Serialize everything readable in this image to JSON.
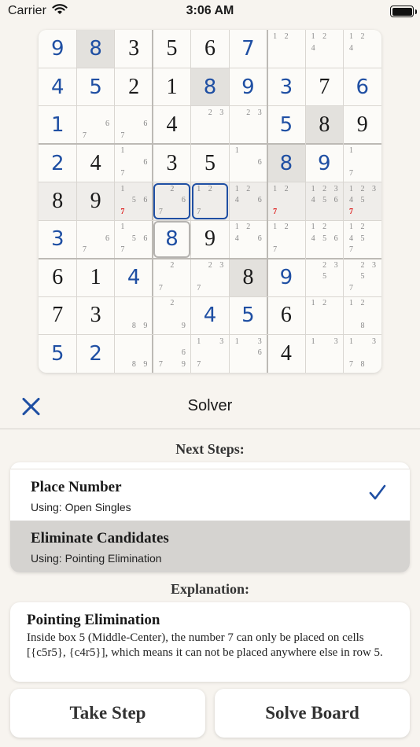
{
  "status_bar": {
    "carrier": "Carrier",
    "time": "3:06 AM"
  },
  "board": {
    "cells": [
      {
        "r": 0,
        "c": 0,
        "v": "9",
        "t": "user"
      },
      {
        "r": 0,
        "c": 1,
        "v": "8",
        "t": "user",
        "sel": true
      },
      {
        "r": 0,
        "c": 2,
        "v": "3",
        "t": "given"
      },
      {
        "r": 0,
        "c": 3,
        "v": "5",
        "t": "given"
      },
      {
        "r": 0,
        "c": 4,
        "v": "6",
        "t": "given"
      },
      {
        "r": 0,
        "c": 5,
        "v": "7",
        "t": "user"
      },
      {
        "r": 0,
        "c": 6,
        "pm": [
          "1",
          "2"
        ]
      },
      {
        "r": 0,
        "c": 7,
        "pm": [
          "1",
          "2",
          "4"
        ]
      },
      {
        "r": 0,
        "c": 8,
        "pm": [
          "1",
          "2",
          "4"
        ]
      },
      {
        "r": 1,
        "c": 0,
        "v": "4",
        "t": "user"
      },
      {
        "r": 1,
        "c": 1,
        "v": "5",
        "t": "user"
      },
      {
        "r": 1,
        "c": 2,
        "v": "2",
        "t": "given"
      },
      {
        "r": 1,
        "c": 3,
        "v": "1",
        "t": "given"
      },
      {
        "r": 1,
        "c": 4,
        "v": "8",
        "t": "user",
        "sel": true
      },
      {
        "r": 1,
        "c": 5,
        "v": "9",
        "t": "user"
      },
      {
        "r": 1,
        "c": 6,
        "v": "3",
        "t": "user"
      },
      {
        "r": 1,
        "c": 7,
        "v": "7",
        "t": "given"
      },
      {
        "r": 1,
        "c": 8,
        "v": "6",
        "t": "user"
      },
      {
        "r": 2,
        "c": 0,
        "v": "1",
        "t": "user"
      },
      {
        "r": 2,
        "c": 1,
        "pm": [
          "6",
          "7"
        ]
      },
      {
        "r": 2,
        "c": 2,
        "pm": [
          "6",
          "7"
        ]
      },
      {
        "r": 2,
        "c": 3,
        "v": "4",
        "t": "given"
      },
      {
        "r": 2,
        "c": 4,
        "pm": [
          "2",
          "3"
        ]
      },
      {
        "r": 2,
        "c": 5,
        "pm": [
          "2",
          "3"
        ]
      },
      {
        "r": 2,
        "c": 6,
        "v": "5",
        "t": "user"
      },
      {
        "r": 2,
        "c": 7,
        "v": "8",
        "t": "given",
        "sel": true
      },
      {
        "r": 2,
        "c": 8,
        "v": "9",
        "t": "given"
      },
      {
        "r": 3,
        "c": 0,
        "v": "2",
        "t": "user"
      },
      {
        "r": 3,
        "c": 1,
        "v": "4",
        "t": "given"
      },
      {
        "r": 3,
        "c": 2,
        "pm": [
          "1",
          "6",
          "7"
        ]
      },
      {
        "r": 3,
        "c": 3,
        "v": "3",
        "t": "given"
      },
      {
        "r": 3,
        "c": 4,
        "v": "5",
        "t": "given"
      },
      {
        "r": 3,
        "c": 5,
        "pm": [
          "1",
          "6"
        ]
      },
      {
        "r": 3,
        "c": 6,
        "v": "8",
        "t": "user",
        "sel": true
      },
      {
        "r": 3,
        "c": 7,
        "v": "9",
        "t": "user"
      },
      {
        "r": 3,
        "c": 8,
        "pm": [
          "1",
          "7"
        ]
      },
      {
        "r": 4,
        "c": 0,
        "v": "8",
        "t": "given",
        "row": true
      },
      {
        "r": 4,
        "c": 1,
        "v": "9",
        "t": "given",
        "row": true
      },
      {
        "r": 4,
        "c": 2,
        "pm": [
          "1",
          "5",
          "6",
          "7"
        ],
        "red": [
          "7"
        ],
        "row": true
      },
      {
        "r": 4,
        "c": 3,
        "pm": [
          "2",
          "6",
          "7"
        ],
        "row": true
      },
      {
        "r": 4,
        "c": 4,
        "pm": [
          "1",
          "2",
          "7"
        ],
        "row": true
      },
      {
        "r": 4,
        "c": 5,
        "pm": [
          "1",
          "2",
          "4",
          "6"
        ],
        "row": true
      },
      {
        "r": 4,
        "c": 6,
        "pm": [
          "1",
          "2",
          "7"
        ],
        "red": [
          "7"
        ],
        "row": true
      },
      {
        "r": 4,
        "c": 7,
        "pm": [
          "1",
          "2",
          "3",
          "4",
          "5",
          "6"
        ],
        "row": true
      },
      {
        "r": 4,
        "c": 8,
        "pm": [
          "1",
          "2",
          "3",
          "4",
          "5",
          "7"
        ],
        "red": [
          "7"
        ],
        "row": true
      },
      {
        "r": 5,
        "c": 0,
        "v": "3",
        "t": "user"
      },
      {
        "r": 5,
        "c": 1,
        "pm": [
          "6",
          "7"
        ]
      },
      {
        "r": 5,
        "c": 2,
        "pm": [
          "1",
          "5",
          "6",
          "7"
        ]
      },
      {
        "r": 5,
        "c": 3,
        "v": "8",
        "t": "user"
      },
      {
        "r": 5,
        "c": 4,
        "v": "9",
        "t": "given"
      },
      {
        "r": 5,
        "c": 5,
        "pm": [
          "1",
          "2",
          "4",
          "6"
        ]
      },
      {
        "r": 5,
        "c": 6,
        "pm": [
          "1",
          "2",
          "7"
        ]
      },
      {
        "r": 5,
        "c": 7,
        "pm": [
          "1",
          "2",
          "4",
          "5",
          "6"
        ]
      },
      {
        "r": 5,
        "c": 8,
        "pm": [
          "1",
          "2",
          "4",
          "5",
          "7"
        ]
      },
      {
        "r": 6,
        "c": 0,
        "v": "6",
        "t": "given"
      },
      {
        "r": 6,
        "c": 1,
        "v": "1",
        "t": "given"
      },
      {
        "r": 6,
        "c": 2,
        "v": "4",
        "t": "user"
      },
      {
        "r": 6,
        "c": 3,
        "pm": [
          "2",
          "7"
        ]
      },
      {
        "r": 6,
        "c": 4,
        "pm": [
          "2",
          "3",
          "7"
        ]
      },
      {
        "r": 6,
        "c": 5,
        "v": "8",
        "t": "given",
        "sel": true
      },
      {
        "r": 6,
        "c": 6,
        "v": "9",
        "t": "user"
      },
      {
        "r": 6,
        "c": 7,
        "pm": [
          "2",
          "3",
          "5"
        ]
      },
      {
        "r": 6,
        "c": 8,
        "pm": [
          "2",
          "3",
          "5",
          "7"
        ]
      },
      {
        "r": 7,
        "c": 0,
        "v": "7",
        "t": "given"
      },
      {
        "r": 7,
        "c": 1,
        "v": "3",
        "t": "given"
      },
      {
        "r": 7,
        "c": 2,
        "pm": [
          "8",
          "9"
        ]
      },
      {
        "r": 7,
        "c": 3,
        "pm": [
          "2",
          "9"
        ]
      },
      {
        "r": 7,
        "c": 4,
        "v": "4",
        "t": "user"
      },
      {
        "r": 7,
        "c": 5,
        "v": "5",
        "t": "user"
      },
      {
        "r": 7,
        "c": 6,
        "v": "6",
        "t": "given"
      },
      {
        "r": 7,
        "c": 7,
        "pm": [
          "1",
          "2"
        ]
      },
      {
        "r": 7,
        "c": 8,
        "pm": [
          "1",
          "2",
          "8"
        ]
      },
      {
        "r": 8,
        "c": 0,
        "v": "5",
        "t": "user"
      },
      {
        "r": 8,
        "c": 1,
        "v": "2",
        "t": "user"
      },
      {
        "r": 8,
        "c": 2,
        "pm": [
          "8",
          "9"
        ]
      },
      {
        "r": 8,
        "c": 3,
        "pm": [
          "6",
          "7",
          "9"
        ]
      },
      {
        "r": 8,
        "c": 4,
        "pm": [
          "1",
          "3",
          "7"
        ]
      },
      {
        "r": 8,
        "c": 5,
        "pm": [
          "1",
          "3",
          "6"
        ]
      },
      {
        "r": 8,
        "c": 6,
        "v": "4",
        "t": "given"
      },
      {
        "r": 8,
        "c": 7,
        "pm": [
          "1",
          "3"
        ]
      },
      {
        "r": 8,
        "c": 8,
        "pm": [
          "1",
          "3",
          "7",
          "8"
        ]
      }
    ],
    "highlight_blue": [
      {
        "r": 4,
        "c": 3
      },
      {
        "r": 4,
        "c": 4
      }
    ],
    "highlight_gray": [
      {
        "r": 5,
        "c": 3
      }
    ]
  },
  "toolbar": {
    "title": "Solver"
  },
  "next_steps": {
    "heading": "Next Steps:",
    "items": [
      {
        "title": "Place Number",
        "subtitle": "Using: Open Singles",
        "checked": true
      },
      {
        "title": "Eliminate Candidates",
        "subtitle": "Using: Pointing Elimination",
        "checked": false
      }
    ]
  },
  "explanation": {
    "heading": "Explanation:",
    "title": "Pointing Elimination",
    "text": "Inside box 5 (Middle-Center), the number 7 can only be placed on cells [{c5r5}, {c4r5}], which means it can not be placed anywhere else in row 5."
  },
  "actions": {
    "take_step": "Take Step",
    "solve_board": "Solve Board"
  },
  "colors": {
    "accent": "#1f4fa3",
    "given": "#1a1a1a",
    "pencil": "#888888",
    "pencil_red": "#dd1111"
  }
}
